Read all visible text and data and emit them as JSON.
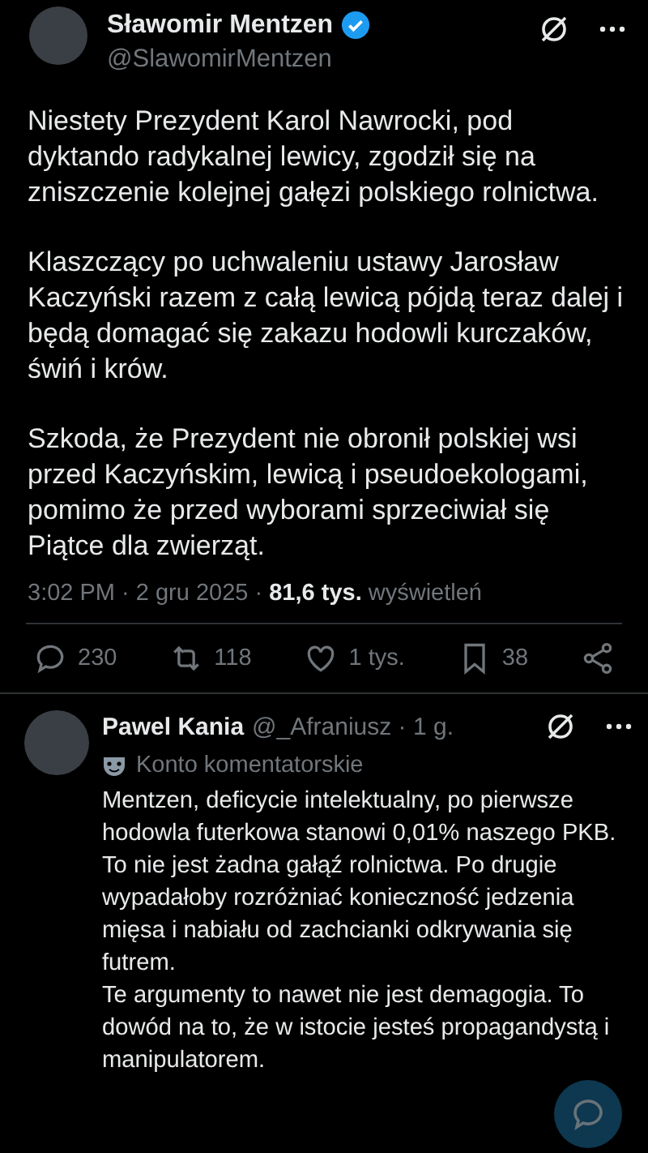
{
  "tweet": {
    "author": {
      "name": "Sławomir Mentzen",
      "handle": "@SlawomirMentzen",
      "verified": true
    },
    "paragraphs": [
      "Niestety Prezydent Karol Nawrocki, pod dyktando radykalnej lewicy, zgodził się na zniszczenie kolejnej gałęzi polskiego rolnictwa.",
      "Klaszczący po uchwaleniu ustawy Jarosław Kaczyński razem z całą lewicą pójdą teraz dalej i będą domagać się zakazu hodowli kurczaków, świń i krów.",
      "Szkoda, że Prezydent nie obronił polskiej wsi przed Kaczyńskim, lewicą i pseudoekologami, pomimo że przed wyborami sprzeciwiał się Piątce dla zwierząt."
    ],
    "meta": "3:02 PM · 2 gru 2025 · **81,6 tys.** wyświetleń",
    "actions": [
      {
        "kind": "reply",
        "count": "230"
      },
      {
        "kind": "repost",
        "count": "118"
      },
      {
        "kind": "like",
        "count": "1 tys."
      },
      {
        "kind": "bookmark",
        "count": "38"
      },
      {
        "kind": "share"
      }
    ]
  },
  "reply": {
    "name": "Pawel Kania",
    "handle": "@_Afraniusz · 1 g.",
    "badge": "Konto komentatorskie",
    "text": "Mentzen, deficycie intelektualny, po pierwsze hodowla futerkowa stanowi 0,01% naszego PKB. To nie jest żadna gałąź rolnictwa. Po drugie wypadałoby rozróżniać konieczność jedzenia mięsa i nabiału od zachcianki odkrywania się futrem.\nTe argumenty to nawet nie jest demagogia. To dowód na to, że w istocie jesteś propagandystą i manipulatorem."
  }
}
